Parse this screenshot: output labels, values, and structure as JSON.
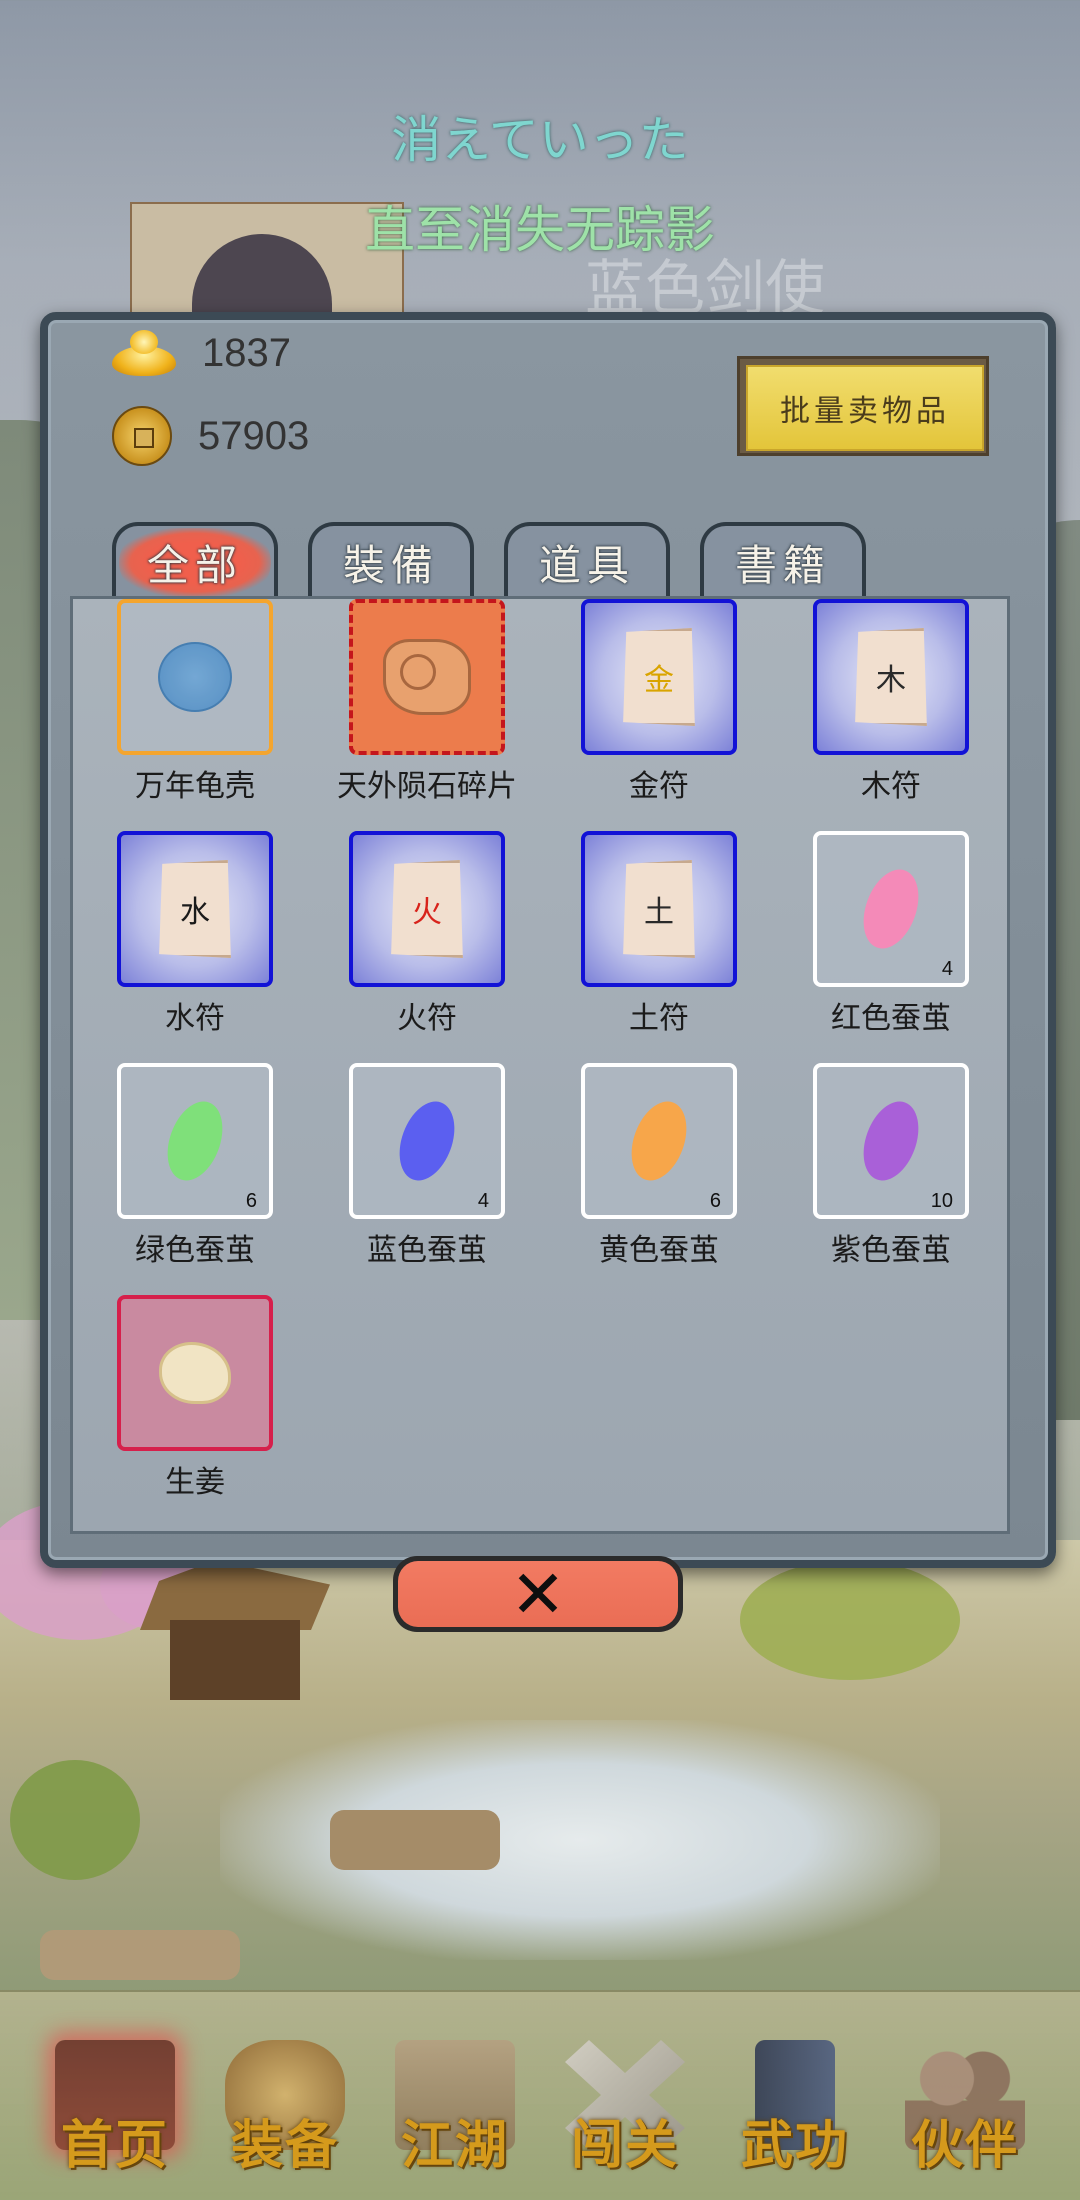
{
  "announcement": {
    "line1": "消えていった",
    "line2": "直至消失无踪影",
    "hero_name": "蓝色剑使"
  },
  "currency": {
    "gold_ingot": "1837",
    "copper_coin": "57903"
  },
  "sell_button_label": "批量卖物品",
  "tabs": [
    {
      "label": "全部",
      "active": true
    },
    {
      "label": "裝備",
      "active": false
    },
    {
      "label": "道具",
      "active": false
    },
    {
      "label": "書籍",
      "active": false
    }
  ],
  "items": [
    {
      "name": "万年龟壳",
      "icon": "turtle-shell-icon",
      "border": "orange"
    },
    {
      "name": "天外陨石碎片",
      "icon": "meteorite-icon",
      "border": "red"
    },
    {
      "name": "金符",
      "icon": "talisman-icon",
      "glyph": "金",
      "glyph_color": "#d9a400",
      "border": "blue"
    },
    {
      "name": "木符",
      "icon": "talisman-icon",
      "glyph": "木",
      "glyph_color": "#2a2a2a",
      "border": "blue"
    },
    {
      "name": "水符",
      "icon": "talisman-icon",
      "glyph": "水",
      "glyph_color": "#1a1a1a",
      "border": "blue"
    },
    {
      "name": "火符",
      "icon": "talisman-icon",
      "glyph": "火",
      "glyph_color": "#d8231b",
      "border": "blue"
    },
    {
      "name": "土符",
      "icon": "talisman-icon",
      "glyph": "土",
      "glyph_color": "#2a2a2a",
      "border": "blue"
    },
    {
      "name": "红色蚕茧",
      "icon": "cocoon-icon",
      "color": "#f48ab8",
      "count": "4",
      "border": "white"
    },
    {
      "name": "绿色蚕茧",
      "icon": "cocoon-icon",
      "color": "#7fe07a",
      "count": "6",
      "border": "white"
    },
    {
      "name": "蓝色蚕茧",
      "icon": "cocoon-icon",
      "color": "#5b5ff0",
      "count": "4",
      "border": "white"
    },
    {
      "name": "黄色蚕茧",
      "icon": "cocoon-icon",
      "color": "#f7a64a",
      "count": "6",
      "border": "white"
    },
    {
      "name": "紫色蚕茧",
      "icon": "cocoon-icon",
      "color": "#a960d8",
      "count": "10",
      "border": "white"
    },
    {
      "name": "生姜",
      "icon": "ginger-icon",
      "border": "pink"
    }
  ],
  "close_button_label": "✕",
  "nav": [
    {
      "label": "首页",
      "icon": "house-icon",
      "active": true,
      "color": "#8b3b2e"
    },
    {
      "label": "装备",
      "icon": "armor-icon",
      "active": false,
      "color": "#b88a3a"
    },
    {
      "label": "江湖",
      "icon": "scroll-map-icon",
      "active": false,
      "color": "#a08a6a"
    },
    {
      "label": "闯关",
      "icon": "crossed-swords-icon",
      "active": false,
      "color": "#b9b2a8"
    },
    {
      "label": "武功",
      "icon": "book-icon",
      "active": false,
      "color": "#3d4a6a"
    },
    {
      "label": "伙伴",
      "icon": "companions-icon",
      "active": false,
      "color": "#8a6c5a"
    }
  ]
}
